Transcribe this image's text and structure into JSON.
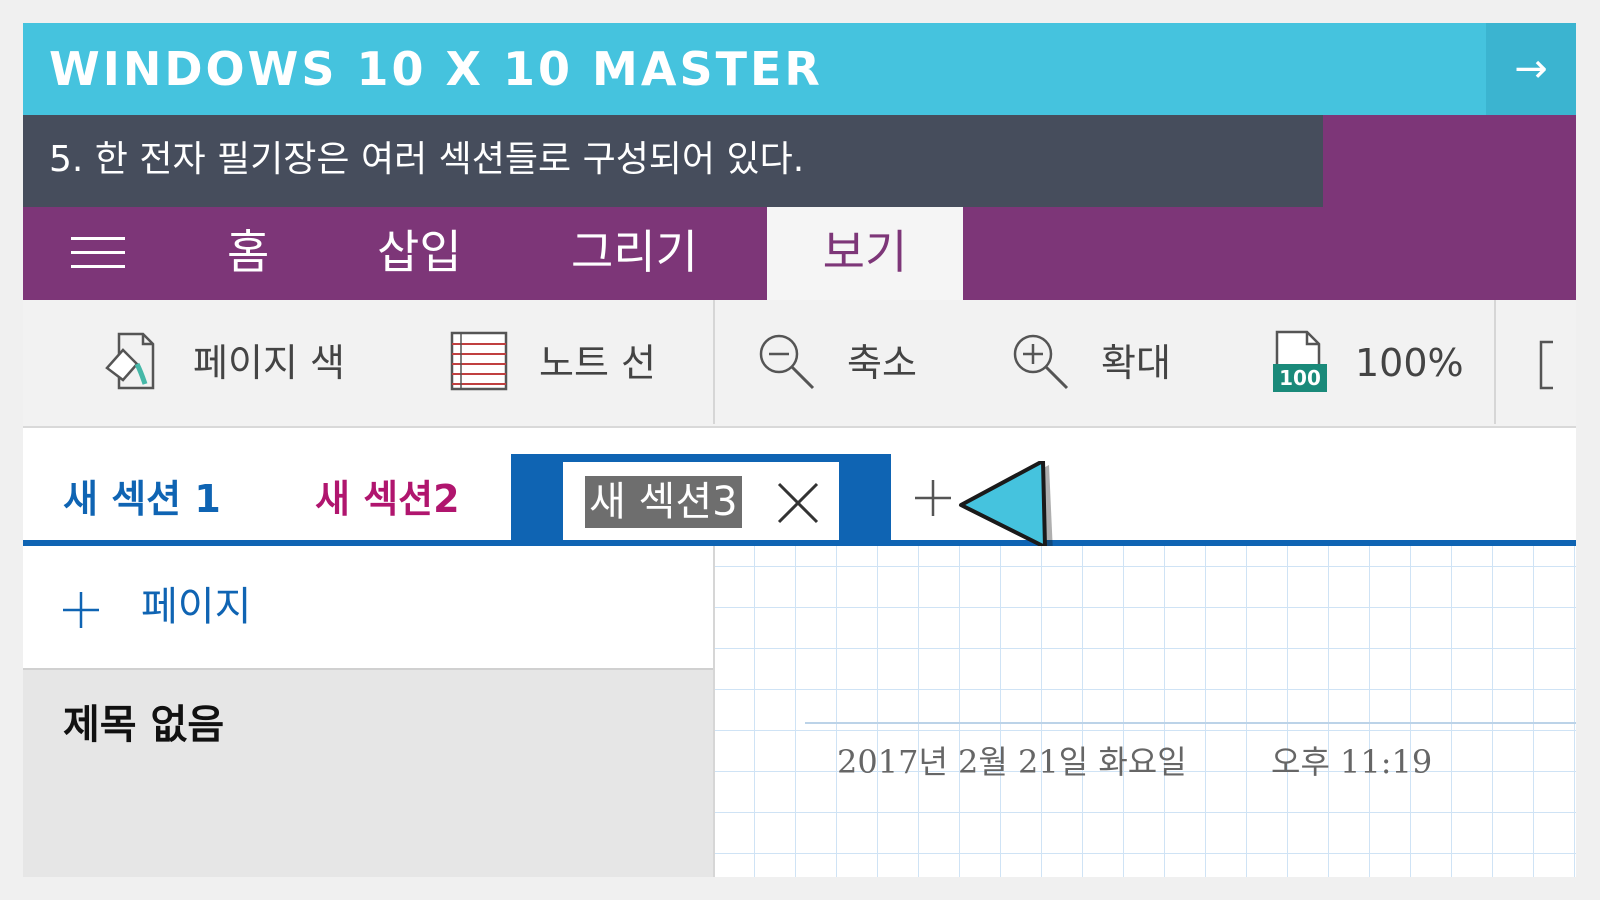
{
  "banner": {
    "title": "WINDOWS 10 X 10 MASTER",
    "next_arrow": "→"
  },
  "step": {
    "text": "5. 한 전자 필기장은 여러 섹션들로 구성되어 있다."
  },
  "ribbon": {
    "tabs": [
      {
        "label": "홈"
      },
      {
        "label": "삽입"
      },
      {
        "label": "그리기"
      },
      {
        "label": "보기"
      }
    ],
    "active_tab": "보기"
  },
  "toolbar": {
    "page_color": "페이지 색",
    "note_lines": "노트 선",
    "zoom_out": "축소",
    "zoom_in": "확대",
    "zoom_100": "100%",
    "zoom_icon_text": "100"
  },
  "sections": {
    "items": [
      {
        "label": "새 섹션 1",
        "color": "#0f64b3"
      },
      {
        "label": "새 섹션2",
        "color": "#b0156e"
      },
      {
        "label": "새 섹션3",
        "color": "#0f64b3"
      }
    ]
  },
  "pages": {
    "add_label": "페이지",
    "items": [
      {
        "title": "제목 없음"
      }
    ]
  },
  "canvas": {
    "date": "2017년 2월 21일 화요일",
    "time": "오후 11:19"
  },
  "colors": {
    "banner": "#45c3de",
    "step_bar": "#464d5c",
    "ribbon": "#7d3678",
    "accent": "#0f64b3",
    "section2": "#b0156e"
  }
}
